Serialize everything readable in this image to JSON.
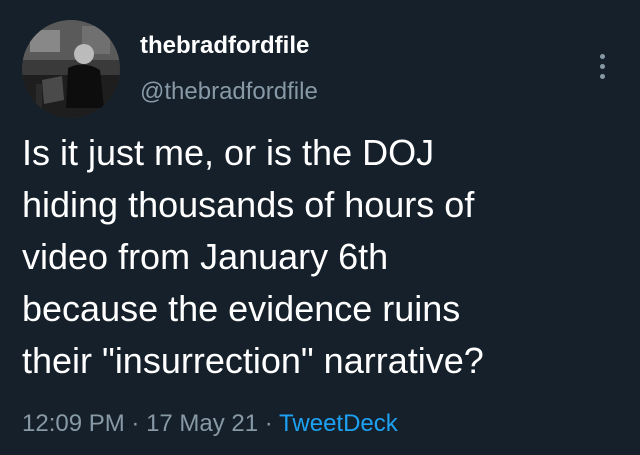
{
  "user": {
    "display_name": "thebradfordfile",
    "handle": "@thebradfordfile"
  },
  "tweet": {
    "lines": [
      "Is it just me, or is the DOJ",
      "hiding thousands of hours of",
      "video from January 6th",
      "because the evidence ruins",
      "their \"insurrection\" narrative?"
    ]
  },
  "meta": {
    "time": "12:09 PM",
    "sep1": " · ",
    "date": "17 May 21",
    "sep2": " · ",
    "source": "TweetDeck"
  },
  "icons": {
    "more": "more-vertical-icon",
    "avatar": "profile-photo"
  },
  "colors": {
    "background": "#15202b",
    "text": "#ffffff",
    "secondary": "#8899a6",
    "accent": "#1da1f2"
  }
}
